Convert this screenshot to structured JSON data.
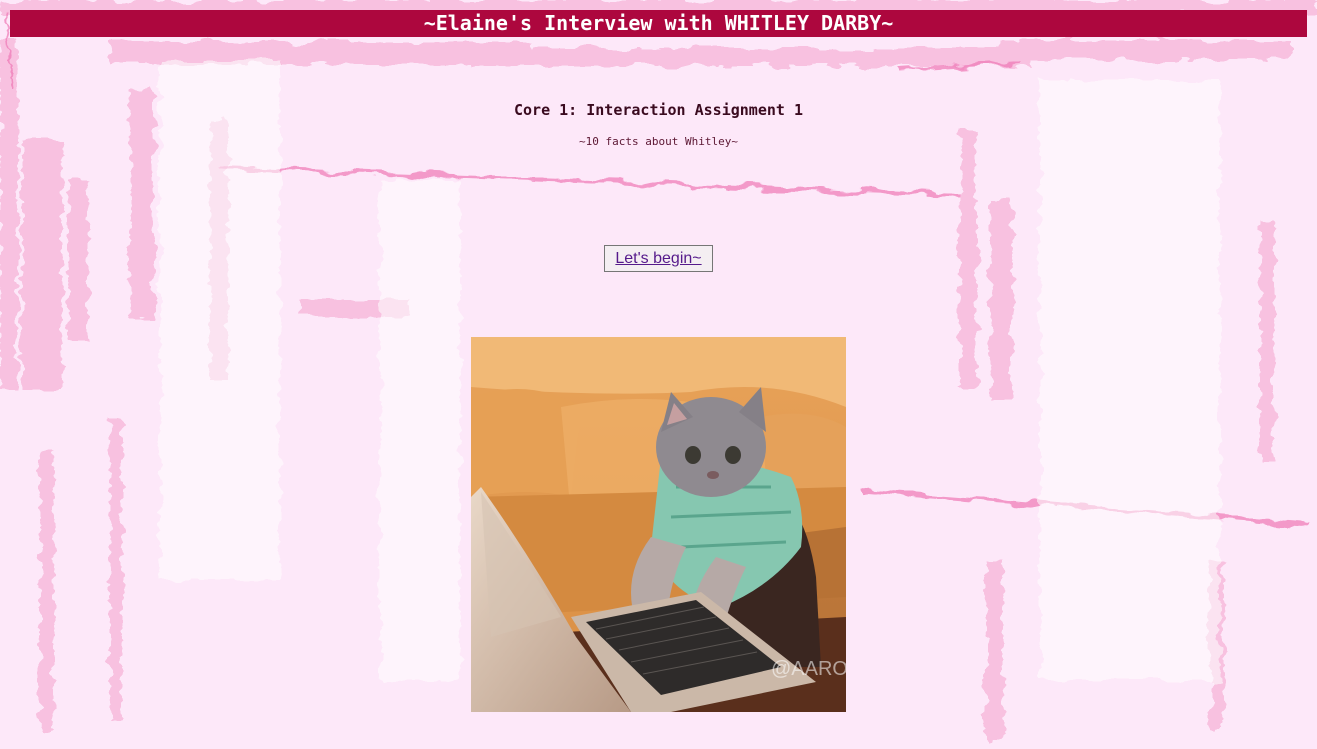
{
  "page": {
    "title": "~Elaine's Interview with WHITLEY DARBY~",
    "heading": "Core 1: Interaction Assignment 1",
    "subheading": "~10 facts about Whitley~",
    "begin_button_label": "Let's begin~",
    "gif_watermark": "@AARON"
  },
  "colors": {
    "title_bar": "#ad073e",
    "background": "#fde8f9",
    "brush_accent": "#f08cc0",
    "link": "#551a8b"
  },
  "icons": {
    "figure": "cat-typing-on-laptop-gif"
  }
}
